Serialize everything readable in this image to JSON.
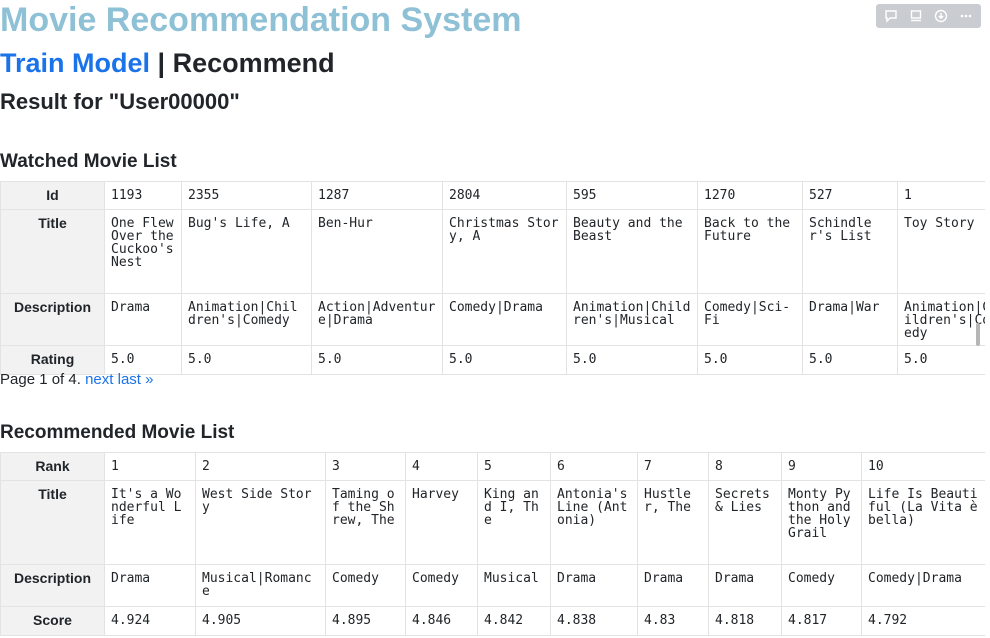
{
  "app": {
    "title": "Movie Recommendation System"
  },
  "nav": {
    "train_label": "Train Model",
    "separator": "|",
    "recommend_label": "Recommend"
  },
  "result_heading": "Result for \"User00000\"",
  "toolbar": {
    "icons": [
      "comment-icon",
      "pin-icon",
      "download-icon",
      "more-icon"
    ]
  },
  "watched": {
    "title": "Watched Movie List",
    "row_labels": [
      "Id",
      "Title",
      "Description",
      "Rating"
    ],
    "rows": [
      [
        "1193",
        "2355",
        "1287",
        "2804",
        "595",
        "1270",
        "527",
        "1"
      ],
      [
        "One Flew Over the Cuckoo's Nest",
        "Bug's Life, A",
        "Ben-Hur",
        "Christmas Story, A",
        "Beauty and the Beast",
        "Back to the Future",
        "Schindler's List",
        "Toy Story"
      ],
      [
        "Drama",
        "Animation|Children's|Comedy",
        "Action|Adventure|Drama",
        "Comedy|Drama",
        "Animation|Children's|Musical",
        "Comedy|Sci-Fi",
        "Drama|War",
        "Animation|Children's|Comedy"
      ],
      [
        "5.0",
        "5.0",
        "5.0",
        "5.0",
        "5.0",
        "5.0",
        "5.0",
        "5.0"
      ]
    ]
  },
  "pager": {
    "text": "Page 1 of 4.",
    "next_label": "next",
    "last_label": "last »"
  },
  "recommended": {
    "title": "Recommended Movie List",
    "row_labels": [
      "Rank",
      "Title",
      "Description",
      "Score"
    ],
    "rows": [
      [
        "1",
        "2",
        "3",
        "4",
        "5",
        "6",
        "7",
        "8",
        "9",
        "10"
      ],
      [
        "It's a Wonderful Life",
        "West Side Story",
        "Taming of the Shrew, The",
        "Harvey",
        "King and I, The",
        "Antonia's Line (Antonia)",
        "Hustler, The",
        "Secrets & Lies",
        "Monty Python and the Holy Grail",
        "Life Is Beautiful (La Vita è bella)"
      ],
      [
        "Drama",
        "Musical|Romance",
        "Comedy",
        "Comedy",
        "Musical",
        "Drama",
        "Drama",
        "Drama",
        "Comedy",
        "Comedy|Drama"
      ],
      [
        "4.924",
        "4.905",
        "4.895",
        "4.846",
        "4.842",
        "4.838",
        "4.83",
        "4.818",
        "4.817",
        "4.792"
      ]
    ]
  }
}
